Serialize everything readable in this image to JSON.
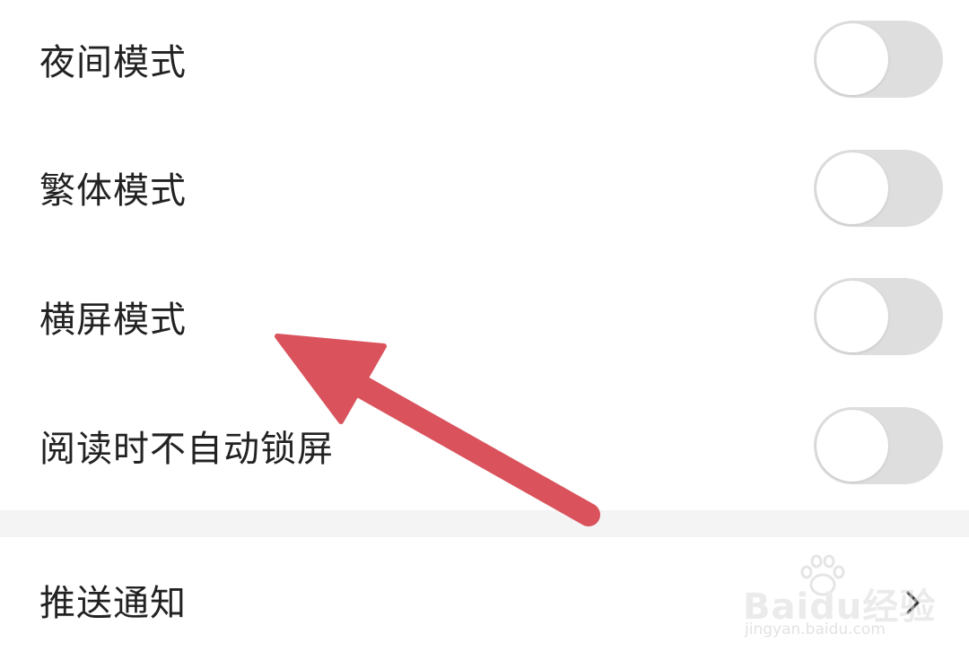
{
  "settings": {
    "items": [
      {
        "label": "夜间模式",
        "toggle_on": false
      },
      {
        "label": "繁体模式",
        "toggle_on": false
      },
      {
        "label": "横屏模式",
        "toggle_on": false
      },
      {
        "label": "阅读时不自动锁屏",
        "toggle_on": false
      }
    ],
    "push": {
      "label": "推送通知",
      "icon": "chevron-right-icon"
    }
  },
  "watermark": {
    "brand": "Baidu经验",
    "url": "jingyan.baidu.com"
  },
  "annotation": {
    "icon": "red-arrow",
    "color": "#d9525c"
  },
  "colors": {
    "toggle_track_off": "#dedede",
    "toggle_knob": "#ffffff",
    "label_text": "#222222",
    "section_gap": "#f4f4f4"
  }
}
